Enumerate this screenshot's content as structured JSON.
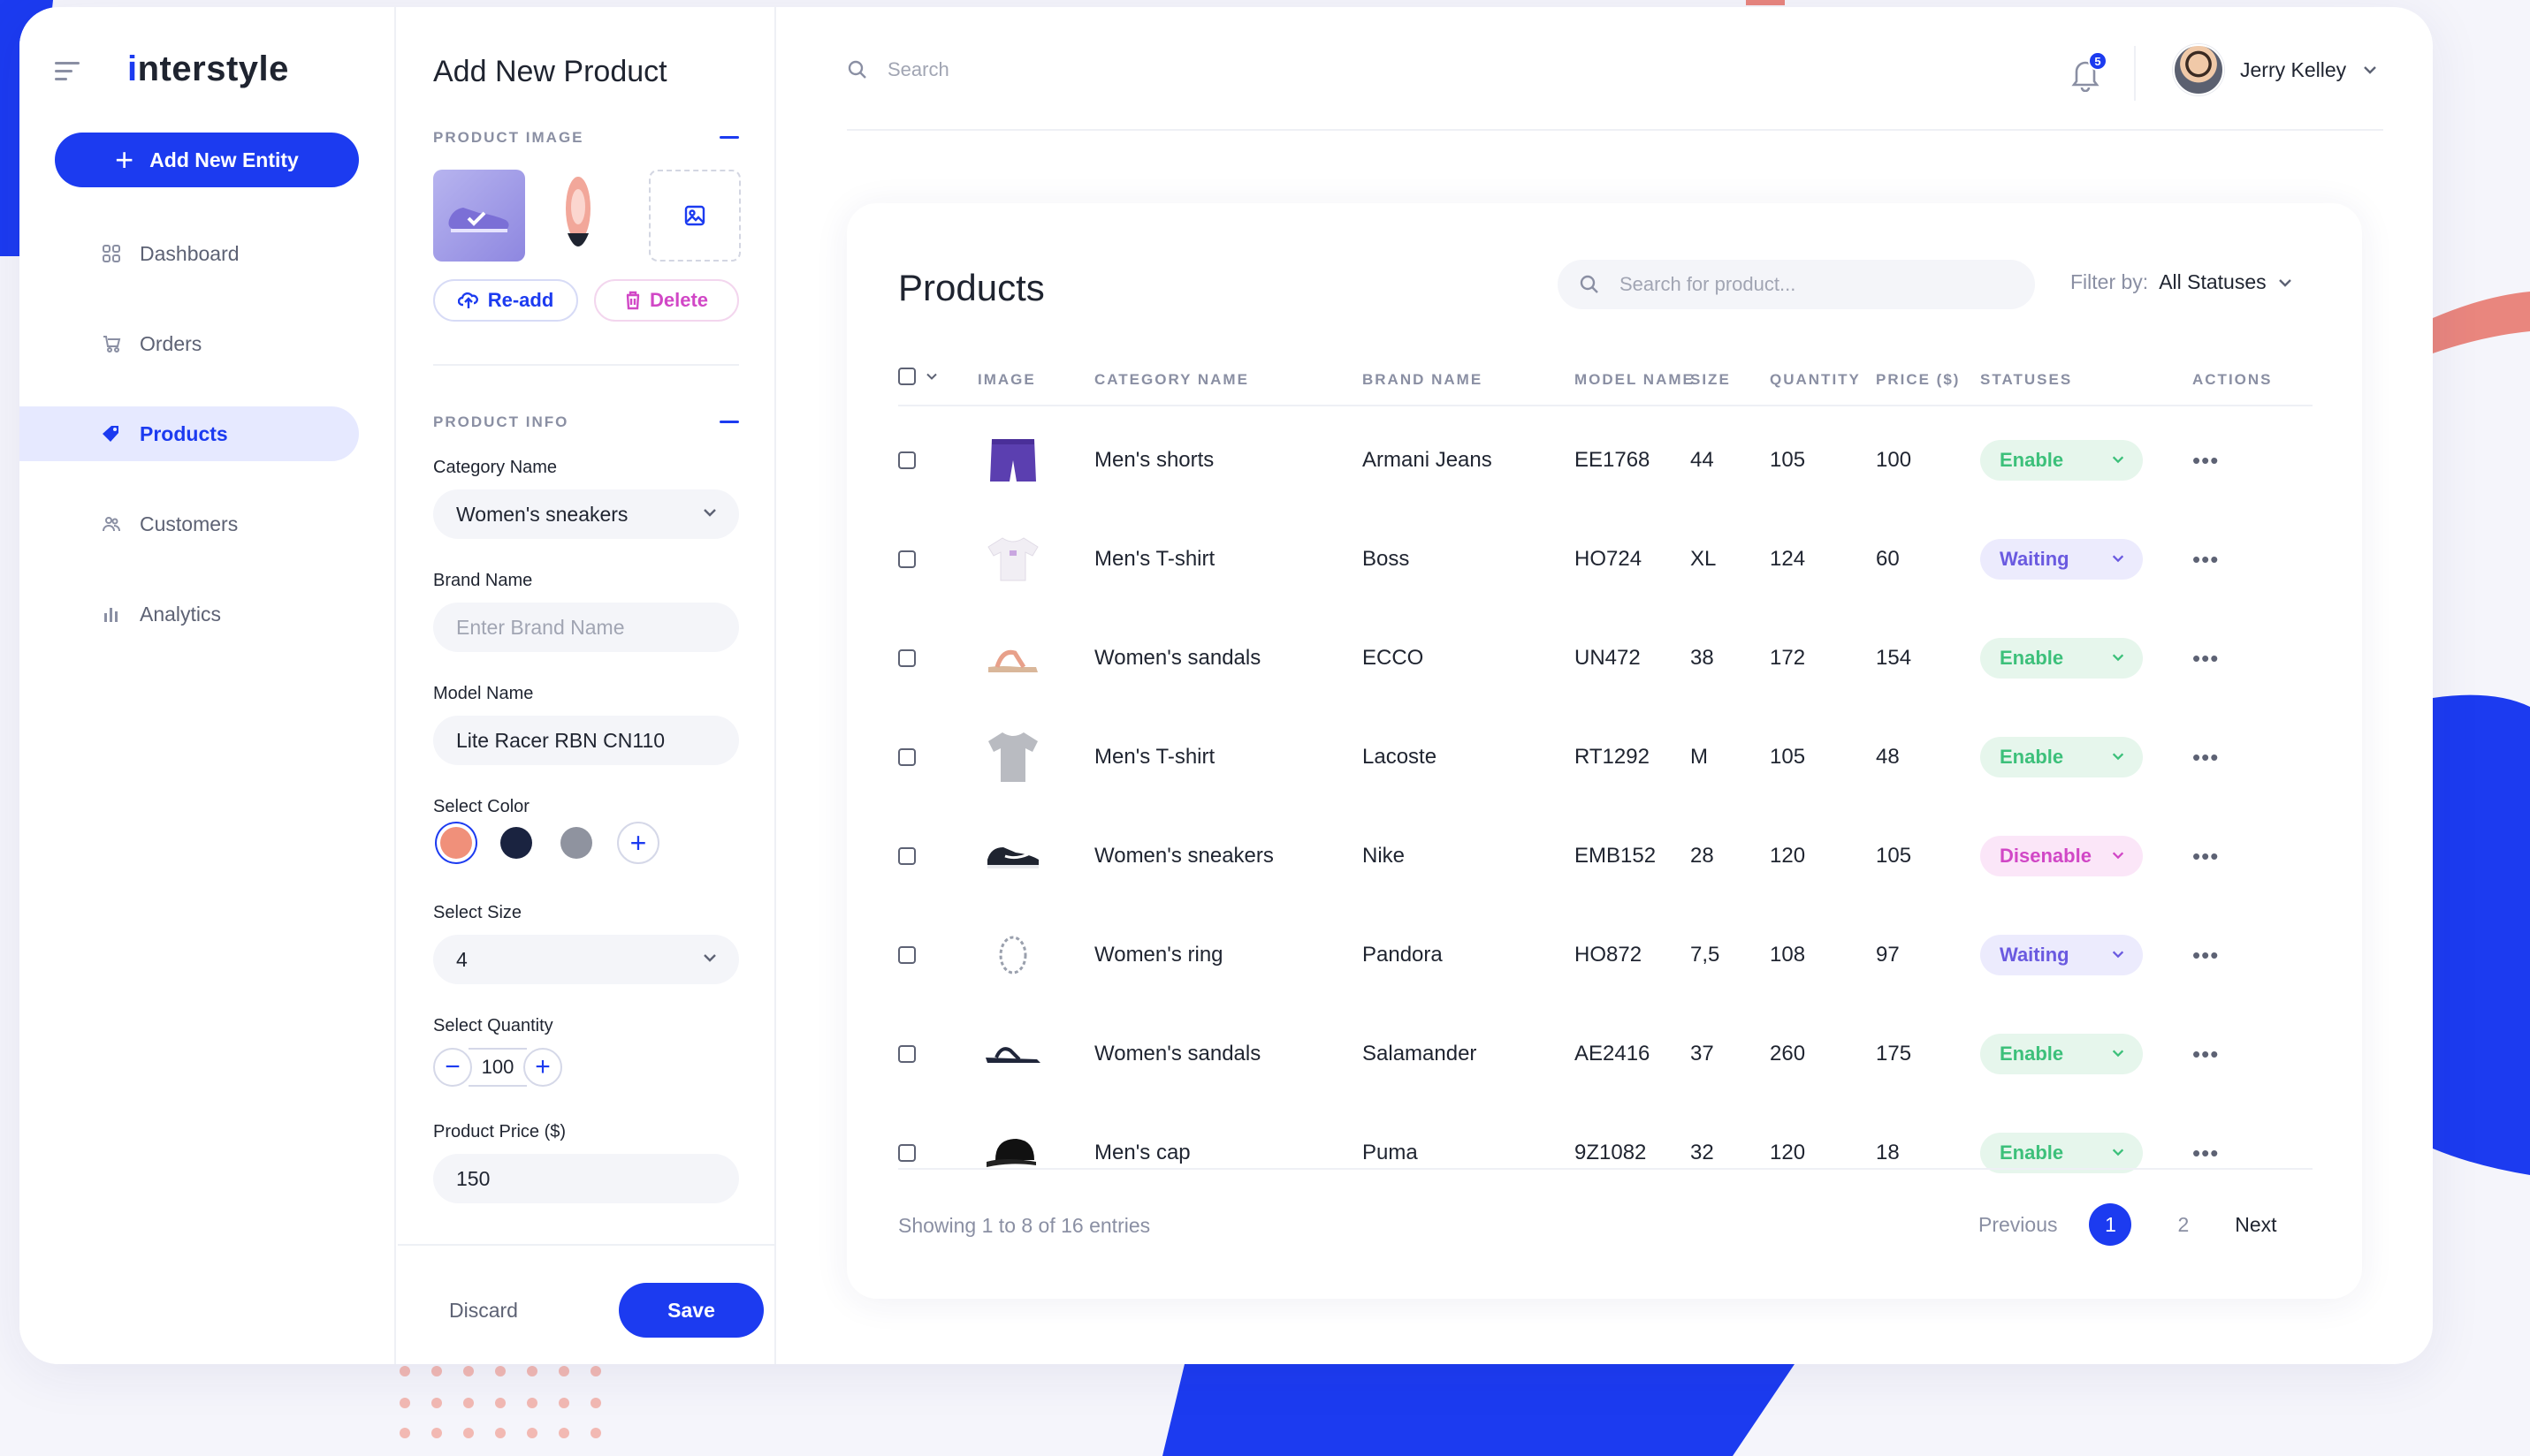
{
  "sidebar": {
    "logo": "interstyle",
    "add_entity": "Add New Entity",
    "items": [
      {
        "label": "Dashboard",
        "icon": "grid-icon"
      },
      {
        "label": "Orders",
        "icon": "cart-icon"
      },
      {
        "label": "Products",
        "icon": "tag-icon"
      },
      {
        "label": "Customers",
        "icon": "users-icon"
      },
      {
        "label": "Analytics",
        "icon": "bar-chart-icon"
      }
    ],
    "active": "Products"
  },
  "form": {
    "title": "Add New Product",
    "product_image_label": "PRODUCT IMAGE",
    "readd": "Re-add",
    "delete": "Delete",
    "product_info_label": "PRODUCT INFO",
    "category_label": "Category Name",
    "category_value": "Women's sneakers",
    "brand_label": "Brand Name",
    "brand_placeholder": "Enter Brand Name",
    "model_label": "Model Name",
    "model_value": "Lite Racer RBN CN110",
    "color_label": "Select Color",
    "colors": [
      "#f0907a",
      "#1a2340",
      "#8f939f"
    ],
    "size_label": "Select Size",
    "size_value": "4",
    "quantity_label": "Select Quantity",
    "quantity_value": "100",
    "price_label": "Product Price ($)",
    "price_value": "150",
    "discard": "Discard",
    "save": "Save"
  },
  "topbar": {
    "search_placeholder": "Search",
    "notifications": "5",
    "user_name": "Jerry Kelley"
  },
  "products": {
    "title": "Products",
    "search_placeholder": "Search for product...",
    "filter_label": "Filter by:",
    "filter_value": "All Statuses",
    "columns": [
      "IMAGE",
      "CATEGORY NAME",
      "BRAND NAME",
      "MODEL NAME",
      "SIZE",
      "QUANTITY",
      "PRICE ($)",
      "STATUSES",
      "ACTIONS"
    ],
    "rows": [
      {
        "category": "Men's shorts",
        "brand": "Armani Jeans",
        "model": "EE1768",
        "size": "44",
        "quantity": "105",
        "price": "100",
        "status": "Enable",
        "image": "shorts"
      },
      {
        "category": "Men's T-shirt",
        "brand": "Boss",
        "model": "HO724",
        "size": "XL",
        "quantity": "124",
        "price": "60",
        "status": "Waiting",
        "image": "tshirt-white"
      },
      {
        "category": "Women's sandals",
        "brand": "ECCO",
        "model": "UN472",
        "size": "38",
        "quantity": "172",
        "price": "154",
        "status": "Enable",
        "image": "sandal-beige"
      },
      {
        "category": "Men's T-shirt",
        "brand": "Lacoste",
        "model": "RT1292",
        "size": "M",
        "quantity": "105",
        "price": "48",
        "status": "Enable",
        "image": "tshirt-grey"
      },
      {
        "category": "Women's sneakers",
        "brand": "Nike",
        "model": "EMB152",
        "size": "28",
        "quantity": "120",
        "price": "105",
        "status": "Disenable",
        "image": "sneaker-black"
      },
      {
        "category": "Women's ring",
        "brand": "Pandora",
        "model": "HO872",
        "size": "7,5",
        "quantity": "108",
        "price": "97",
        "status": "Waiting",
        "image": "ring"
      },
      {
        "category": "Women's sandals",
        "brand": "Salamander",
        "model": "AE2416",
        "size": "37",
        "quantity": "260",
        "price": "175",
        "status": "Enable",
        "image": "sandal-black"
      },
      {
        "category": "Men's cap",
        "brand": "Puma",
        "model": "9Z1082",
        "size": "32",
        "quantity": "120",
        "price": "18",
        "status": "Enable",
        "image": "cap"
      }
    ],
    "showing": "Showing 1 to 8 of 16 entries",
    "pagination": {
      "previous": "Previous",
      "pages": [
        "1",
        "2"
      ],
      "current": "1",
      "next": "Next"
    }
  },
  "colors": {
    "accent": "#1c3bf0",
    "enable": "#3cc07a",
    "waiting": "#6a5ae0",
    "disenable": "#d147c6"
  }
}
